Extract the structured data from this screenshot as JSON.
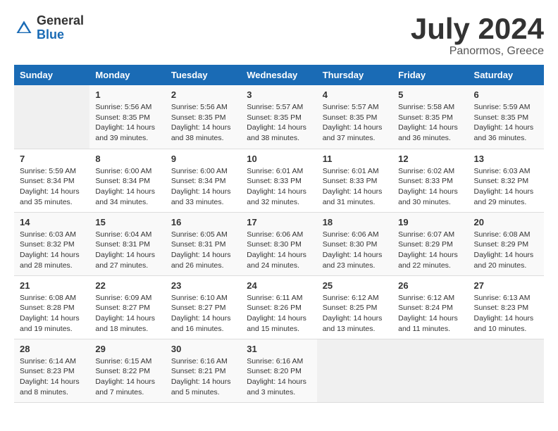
{
  "logo": {
    "general": "General",
    "blue": "Blue"
  },
  "title": {
    "month_year": "July 2024",
    "location": "Panormos, Greece"
  },
  "calendar": {
    "headers": [
      "Sunday",
      "Monday",
      "Tuesday",
      "Wednesday",
      "Thursday",
      "Friday",
      "Saturday"
    ],
    "weeks": [
      [
        {
          "date": "",
          "info": ""
        },
        {
          "date": "1",
          "info": "Sunrise: 5:56 AM\nSunset: 8:35 PM\nDaylight: 14 hours\nand 39 minutes."
        },
        {
          "date": "2",
          "info": "Sunrise: 5:56 AM\nSunset: 8:35 PM\nDaylight: 14 hours\nand 38 minutes."
        },
        {
          "date": "3",
          "info": "Sunrise: 5:57 AM\nSunset: 8:35 PM\nDaylight: 14 hours\nand 38 minutes."
        },
        {
          "date": "4",
          "info": "Sunrise: 5:57 AM\nSunset: 8:35 PM\nDaylight: 14 hours\nand 37 minutes."
        },
        {
          "date": "5",
          "info": "Sunrise: 5:58 AM\nSunset: 8:35 PM\nDaylight: 14 hours\nand 36 minutes."
        },
        {
          "date": "6",
          "info": "Sunrise: 5:59 AM\nSunset: 8:35 PM\nDaylight: 14 hours\nand 36 minutes."
        }
      ],
      [
        {
          "date": "7",
          "info": "Sunrise: 5:59 AM\nSunset: 8:34 PM\nDaylight: 14 hours\nand 35 minutes."
        },
        {
          "date": "8",
          "info": "Sunrise: 6:00 AM\nSunset: 8:34 PM\nDaylight: 14 hours\nand 34 minutes."
        },
        {
          "date": "9",
          "info": "Sunrise: 6:00 AM\nSunset: 8:34 PM\nDaylight: 14 hours\nand 33 minutes."
        },
        {
          "date": "10",
          "info": "Sunrise: 6:01 AM\nSunset: 8:33 PM\nDaylight: 14 hours\nand 32 minutes."
        },
        {
          "date": "11",
          "info": "Sunrise: 6:01 AM\nSunset: 8:33 PM\nDaylight: 14 hours\nand 31 minutes."
        },
        {
          "date": "12",
          "info": "Sunrise: 6:02 AM\nSunset: 8:33 PM\nDaylight: 14 hours\nand 30 minutes."
        },
        {
          "date": "13",
          "info": "Sunrise: 6:03 AM\nSunset: 8:32 PM\nDaylight: 14 hours\nand 29 minutes."
        }
      ],
      [
        {
          "date": "14",
          "info": "Sunrise: 6:03 AM\nSunset: 8:32 PM\nDaylight: 14 hours\nand 28 minutes."
        },
        {
          "date": "15",
          "info": "Sunrise: 6:04 AM\nSunset: 8:31 PM\nDaylight: 14 hours\nand 27 minutes."
        },
        {
          "date": "16",
          "info": "Sunrise: 6:05 AM\nSunset: 8:31 PM\nDaylight: 14 hours\nand 26 minutes."
        },
        {
          "date": "17",
          "info": "Sunrise: 6:06 AM\nSunset: 8:30 PM\nDaylight: 14 hours\nand 24 minutes."
        },
        {
          "date": "18",
          "info": "Sunrise: 6:06 AM\nSunset: 8:30 PM\nDaylight: 14 hours\nand 23 minutes."
        },
        {
          "date": "19",
          "info": "Sunrise: 6:07 AM\nSunset: 8:29 PM\nDaylight: 14 hours\nand 22 minutes."
        },
        {
          "date": "20",
          "info": "Sunrise: 6:08 AM\nSunset: 8:29 PM\nDaylight: 14 hours\nand 20 minutes."
        }
      ],
      [
        {
          "date": "21",
          "info": "Sunrise: 6:08 AM\nSunset: 8:28 PM\nDaylight: 14 hours\nand 19 minutes."
        },
        {
          "date": "22",
          "info": "Sunrise: 6:09 AM\nSunset: 8:27 PM\nDaylight: 14 hours\nand 18 minutes."
        },
        {
          "date": "23",
          "info": "Sunrise: 6:10 AM\nSunset: 8:27 PM\nDaylight: 14 hours\nand 16 minutes."
        },
        {
          "date": "24",
          "info": "Sunrise: 6:11 AM\nSunset: 8:26 PM\nDaylight: 14 hours\nand 15 minutes."
        },
        {
          "date": "25",
          "info": "Sunrise: 6:12 AM\nSunset: 8:25 PM\nDaylight: 14 hours\nand 13 minutes."
        },
        {
          "date": "26",
          "info": "Sunrise: 6:12 AM\nSunset: 8:24 PM\nDaylight: 14 hours\nand 11 minutes."
        },
        {
          "date": "27",
          "info": "Sunrise: 6:13 AM\nSunset: 8:23 PM\nDaylight: 14 hours\nand 10 minutes."
        }
      ],
      [
        {
          "date": "28",
          "info": "Sunrise: 6:14 AM\nSunset: 8:23 PM\nDaylight: 14 hours\nand 8 minutes."
        },
        {
          "date": "29",
          "info": "Sunrise: 6:15 AM\nSunset: 8:22 PM\nDaylight: 14 hours\nand 7 minutes."
        },
        {
          "date": "30",
          "info": "Sunrise: 6:16 AM\nSunset: 8:21 PM\nDaylight: 14 hours\nand 5 minutes."
        },
        {
          "date": "31",
          "info": "Sunrise: 6:16 AM\nSunset: 8:20 PM\nDaylight: 14 hours\nand 3 minutes."
        },
        {
          "date": "",
          "info": ""
        },
        {
          "date": "",
          "info": ""
        },
        {
          "date": "",
          "info": ""
        }
      ]
    ]
  }
}
